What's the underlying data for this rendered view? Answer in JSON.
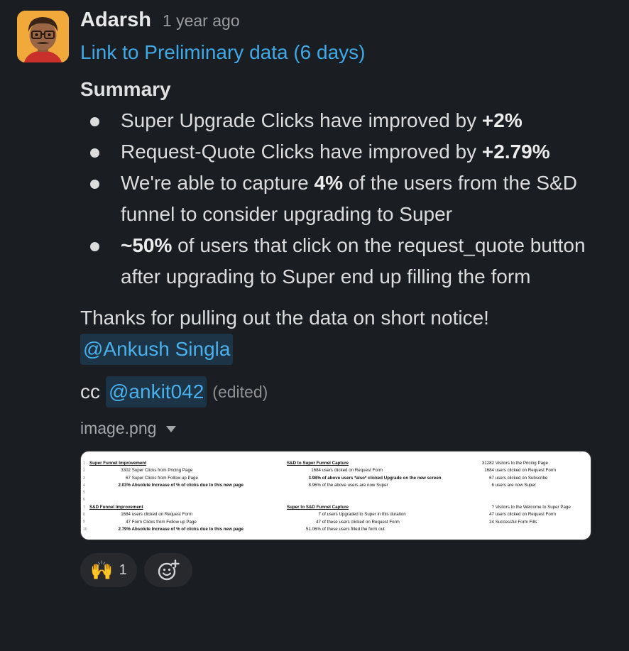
{
  "message": {
    "author": "Adarsh",
    "timestamp": "1 year ago",
    "link_text": "Link to Preliminary data (6 days)",
    "summary_title": "Summary",
    "bullets": [
      {
        "pre": "Super Upgrade Clicks have improved by ",
        "bold": "+2%",
        "post": ""
      },
      {
        "pre": "Request-Quote Clicks have improved by ",
        "bold": "+2.79%",
        "post": ""
      },
      {
        "pre": "We're able to capture ",
        "bold": "4%",
        "post": " of the users from the S&D funnel to consider upgrading to Super"
      },
      {
        "pre": "",
        "bold": "~50%",
        "post": " of users that click on the request_quote button after upgrading to Super end up filling the form"
      }
    ],
    "thanks": "Thanks for pulling out the data on short notice!",
    "mention_1": "@Ankush Singla",
    "cc_prefix": "cc",
    "mention_2": "@ankit042",
    "edited": "(edited)",
    "file_name": "image.png"
  },
  "attachment": {
    "columns": [
      {
        "sections": [
          {
            "title": "Super Funnel Improvement",
            "rows": [
              {
                "n": "3302",
                "t": "Super Clicks from Pricing Page",
                "bold": false
              },
              {
                "n": "67",
                "t": "Super Clicks from Follow up Page",
                "bold": false
              },
              {
                "n": "2.03%",
                "t": "Absolute Increase of % of clicks due to this new page",
                "bold": true
              }
            ]
          },
          {
            "title": "S&D Funnel Improvement",
            "rows": [
              {
                "n": "1684",
                "t": "users clicked on Request Form",
                "bold": false
              },
              {
                "n": "47",
                "t": "Form Clicks from Follow up Page",
                "bold": false
              },
              {
                "n": "2.79%",
                "t": "Absolute Increase of % of clicks due to this new page",
                "bold": true
              }
            ]
          }
        ]
      },
      {
        "sections": [
          {
            "title": "S&D to Super Funnel Capture",
            "rows": [
              {
                "n": "1684",
                "t": "users clicked on Request Form",
                "bold": false
              },
              {
                "n": "3.98%",
                "t": "of above users *also* clicked Upgrade on the new screen",
                "bold": true
              },
              {
                "n": "8.96%",
                "t": "of the above users are now Super",
                "bold": false
              }
            ]
          },
          {
            "title": "Super to S&D Funnel Capture",
            "rows": [
              {
                "n": "7",
                "t": "of users Upgraded to Super in this duration",
                "bold": false
              },
              {
                "n": "47",
                "t": "of these users clicked on Request Form",
                "bold": false
              },
              {
                "n": "51.06%",
                "t": "of these users filled the form out",
                "bold": false
              }
            ]
          }
        ]
      },
      {
        "sections": [
          {
            "title": "",
            "rows": [
              {
                "n": "31282",
                "t": "Visitors to the Pricing Page",
                "bold": false
              },
              {
                "n": "1684",
                "t": "users clicked on Request Form",
                "bold": false
              },
              {
                "n": "67",
                "t": "users clicked on Subscribe",
                "bold": false
              },
              {
                "n": "6",
                "t": "users are now Super",
                "bold": false
              }
            ]
          },
          {
            "title": "",
            "rows": [
              {
                "n": "?",
                "t": "Visitors to the Welcome to Super Page",
                "bold": false
              },
              {
                "n": "47",
                "t": "users clicked on Request Form",
                "bold": false
              },
              {
                "n": "24",
                "t": "Successful Form Fills",
                "bold": false
              }
            ]
          }
        ]
      }
    ]
  },
  "reactions": [
    {
      "emoji": "🙌",
      "count": "1",
      "icon": "raised-hands-icon"
    },
    {
      "emoji": "",
      "count": "",
      "icon": "add-reaction-icon"
    }
  ],
  "colors": {
    "background": "#1a1d21",
    "link": "#3fa8e6",
    "mention_bg": "#1d3346",
    "mention_text": "#4ab0ea",
    "avatar_bg": "#f2a93b"
  }
}
